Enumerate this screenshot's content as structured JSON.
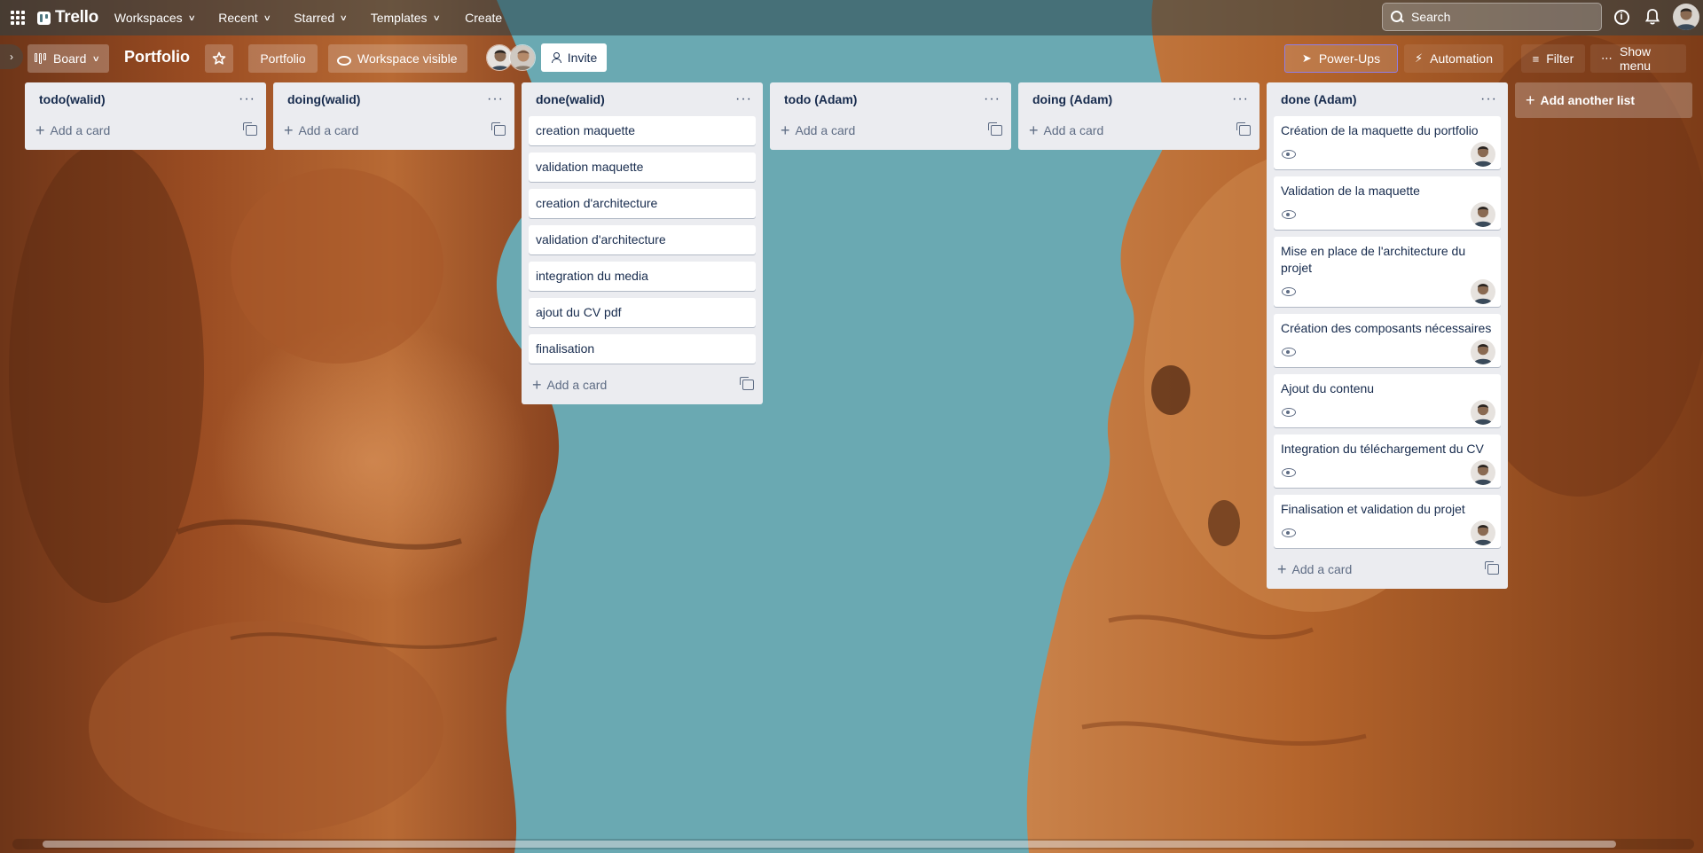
{
  "colors": {
    "list_bg": "#ebecf0",
    "header_bg": "#284248",
    "sky": "#6aa9b2",
    "rock": "#b8642a",
    "powerups_border": "#8f7ee7"
  },
  "header": {
    "logo": "Trello",
    "nav": [
      {
        "label": "Workspaces"
      },
      {
        "label": "Recent"
      },
      {
        "label": "Starred"
      },
      {
        "label": "Templates"
      }
    ],
    "create_label": "Create",
    "search_placeholder": "Search",
    "icons": [
      "apps-grid-icon",
      "info-icon",
      "bell-icon",
      "avatar"
    ]
  },
  "board_header": {
    "view_label": "Board",
    "title": "Portfolio",
    "team_label": "Portfolio",
    "visibility_label": "Workspace visible",
    "invite_label": "Invite",
    "powerups_label": "Power-Ups",
    "automation_label": "Automation",
    "filter_label": "Filter",
    "show_menu_label": "Show menu"
  },
  "lists": [
    {
      "title": "todo(walid)",
      "cards": [],
      "add_label": "Add a card"
    },
    {
      "title": "doing(walid)",
      "cards": [],
      "add_label": "Add a card"
    },
    {
      "title": "done(walid)",
      "cards": [
        "creation maquette",
        "validation maquette",
        "creation d'architecture",
        "validation d'architecture",
        "integration du media",
        "ajout du CV pdf",
        "finalisation"
      ],
      "add_label": "Add a card"
    },
    {
      "title": "todo (Adam)",
      "cards": [],
      "add_label": "Add a card"
    },
    {
      "title": "doing (Adam)",
      "cards": [],
      "add_label": "Add a card"
    },
    {
      "title": "done (Adam)",
      "cards": [
        "Création de la maquette du portfolio",
        "Validation de la maquette",
        "Mise en place de l'architecture du projet",
        "Création des composants nécessaires",
        "Ajout du contenu",
        "Integration du téléchargement du CV",
        "Finalisation et validation du projet"
      ],
      "add_label": "Add a card"
    }
  ],
  "add_list_label": "Add another list"
}
